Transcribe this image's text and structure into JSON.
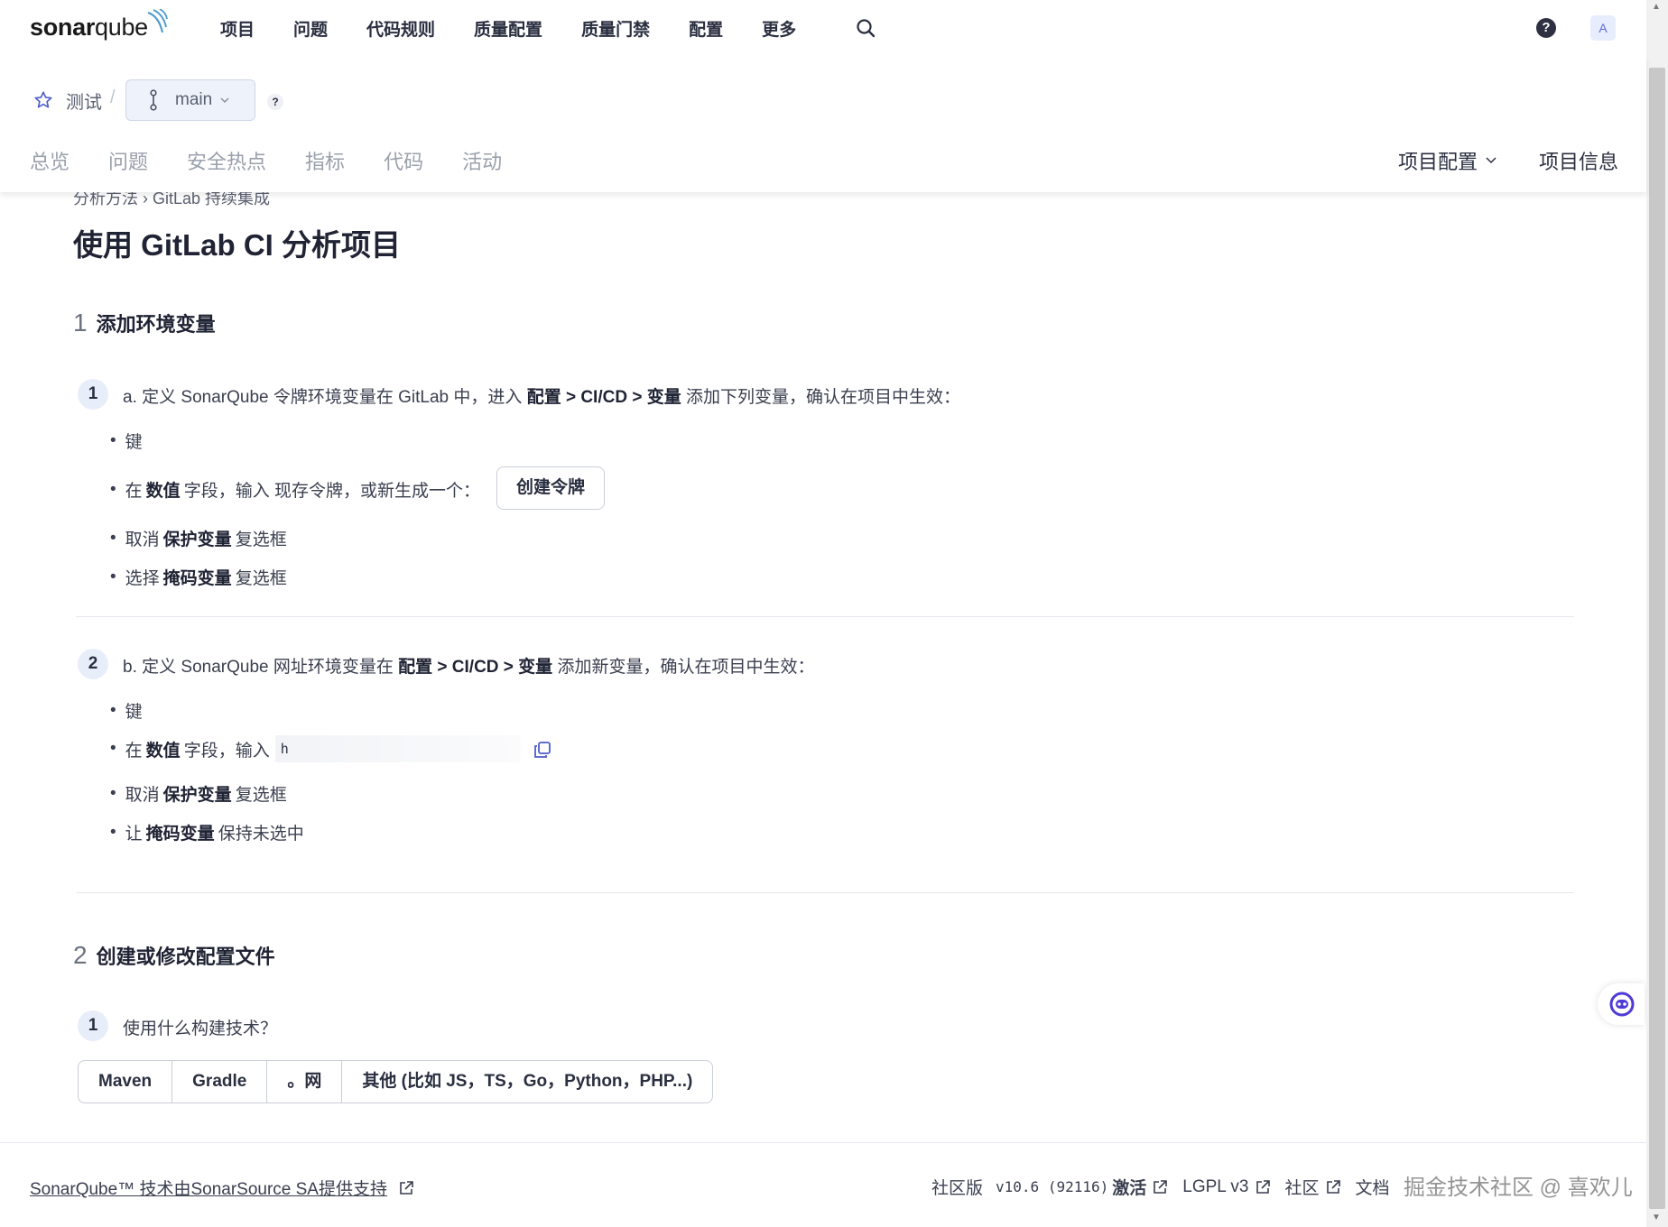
{
  "brand": {
    "logo_text_bold": "sonar",
    "logo_text": "qube"
  },
  "topnav": {
    "items": [
      "项目",
      "问题",
      "代码规则",
      "质量配置",
      "质量门禁",
      "配置",
      "更多"
    ],
    "help": "?",
    "avatar": "A"
  },
  "project": {
    "name": "测试",
    "separator": "/",
    "branch": "main",
    "branch_help": "?",
    "tabs": [
      "总览",
      "问题",
      "安全热点",
      "指标",
      "代码",
      "活动"
    ],
    "config_menu": "项目配置",
    "info_link": "项目信息"
  },
  "main": {
    "breadcrumb": "分析方法 › GitLab 持续集成",
    "title": "使用 GitLab CI 分析项目",
    "section1": {
      "number": "1",
      "title": "添加环境变量",
      "stepA": {
        "number": "1",
        "text_prefix": "a. 定义 SonarQube 令牌环境变量在 GitLab 中，进入",
        "path": "配置 > CI/CD > 变量",
        "text_suffix": "添加下列变量，确认在项目中生效：",
        "bullets": {
          "key": "键",
          "value_prefix": "在",
          "value_bold": "数值",
          "value_suffix": "字段，输入 现存令牌，或新生成一个：",
          "create_token": "创建令牌",
          "protect_prefix": "取消",
          "protect_bold": "保护变量",
          "protect_suffix": "复选框",
          "mask_prefix": "选择",
          "mask_bold": "掩码变量",
          "mask_suffix": "复选框"
        }
      },
      "stepB": {
        "number": "2",
        "text_prefix": "b. 定义 SonarQube 网址环境变量在",
        "path": "配置 > CI/CD > 变量",
        "text_suffix": "添加新变量，确认在项目中生效：",
        "bullets": {
          "key": "键",
          "value_prefix": "在",
          "value_bold": "数值",
          "value_suffix": "字段，输入",
          "url_value": "h",
          "protect_prefix": "取消",
          "protect_bold": "保护变量",
          "protect_suffix": "复选框",
          "mask_prefix": "让",
          "mask_bold": "掩码变量",
          "mask_suffix": "保持未选中"
        }
      }
    },
    "section2": {
      "number": "2",
      "title": "创建或修改配置文件",
      "step": {
        "number": "1",
        "question": "使用什么构建技术？"
      },
      "options": [
        "Maven",
        "Gradle",
        "。网",
        "其他 (比如 JS，TS，Go，Python，PHP...)"
      ]
    }
  },
  "footer": {
    "powered_by": "SonarQube™ 技术由SonarSource SA提供支持",
    "edition": "社区版",
    "version": "v10.6 (92116)",
    "activate": "激活",
    "license": "LGPL v3",
    "community": "社区",
    "docs": "文档",
    "watermark": "掘金技术社区 @ 喜欢儿"
  },
  "colors": {
    "accent": "#5b6ad6",
    "text": "#2a2f40",
    "muted_tab": "#9aa0ac",
    "step_badge": "#e8edfa",
    "divider": "#e6e8ee"
  }
}
